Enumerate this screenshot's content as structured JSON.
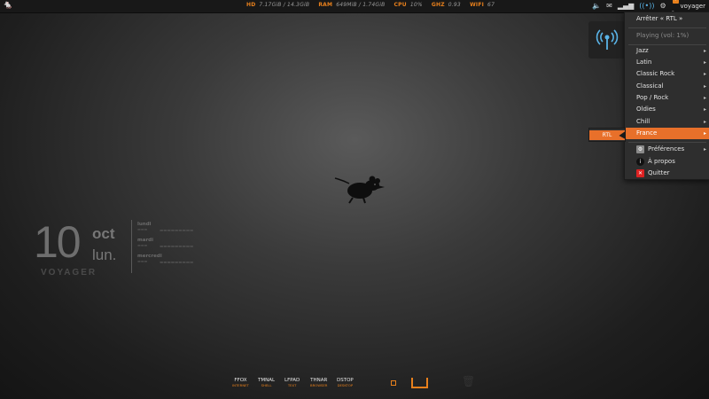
{
  "panel": {
    "sysinfo": [
      {
        "label": "HD",
        "value": "7.17GiB / 14.3GiB"
      },
      {
        "label": "RAM",
        "value": "649MiB / 1.74GiB"
      },
      {
        "label": "CPU",
        "value": "10%"
      },
      {
        "label": "GHZ",
        "value": "0.93"
      },
      {
        "label": "WIFI",
        "value": "67"
      }
    ],
    "notification_count": "2",
    "notification_badge": "!",
    "username": "voyager"
  },
  "menu": {
    "stop": "Arrêter « RTL »",
    "playing": "Playing (vol: 1%)",
    "genres": [
      "Jazz",
      "Latin",
      "Classic Rock",
      "Classical",
      "Pop / Rock",
      "Oldies",
      "Chill",
      "France"
    ],
    "preferences": "Préférences",
    "about": "À propos",
    "quit": "Quitter",
    "submenu_item": "RTL"
  },
  "date_widget": {
    "day": "10",
    "month": "oct",
    "weekday": "lun.",
    "hostname": "VOYAGER",
    "forecast": [
      {
        "day": "lundi"
      },
      {
        "day": "mardi"
      },
      {
        "day": "mercredi"
      }
    ]
  },
  "dock": [
    {
      "label": "FFOX",
      "sub": "INTERNET"
    },
    {
      "label": "TMNAL",
      "sub": "SHELL"
    },
    {
      "label": "LFPAD",
      "sub": "TEXT"
    },
    {
      "label": "THNAR",
      "sub": "BROWSER"
    },
    {
      "label": "DSTOP",
      "sub": "DESKTOP"
    }
  ],
  "colors": {
    "accent": "#e8702a",
    "panel": "#181818",
    "menu_bg": "#2e2e2e"
  }
}
